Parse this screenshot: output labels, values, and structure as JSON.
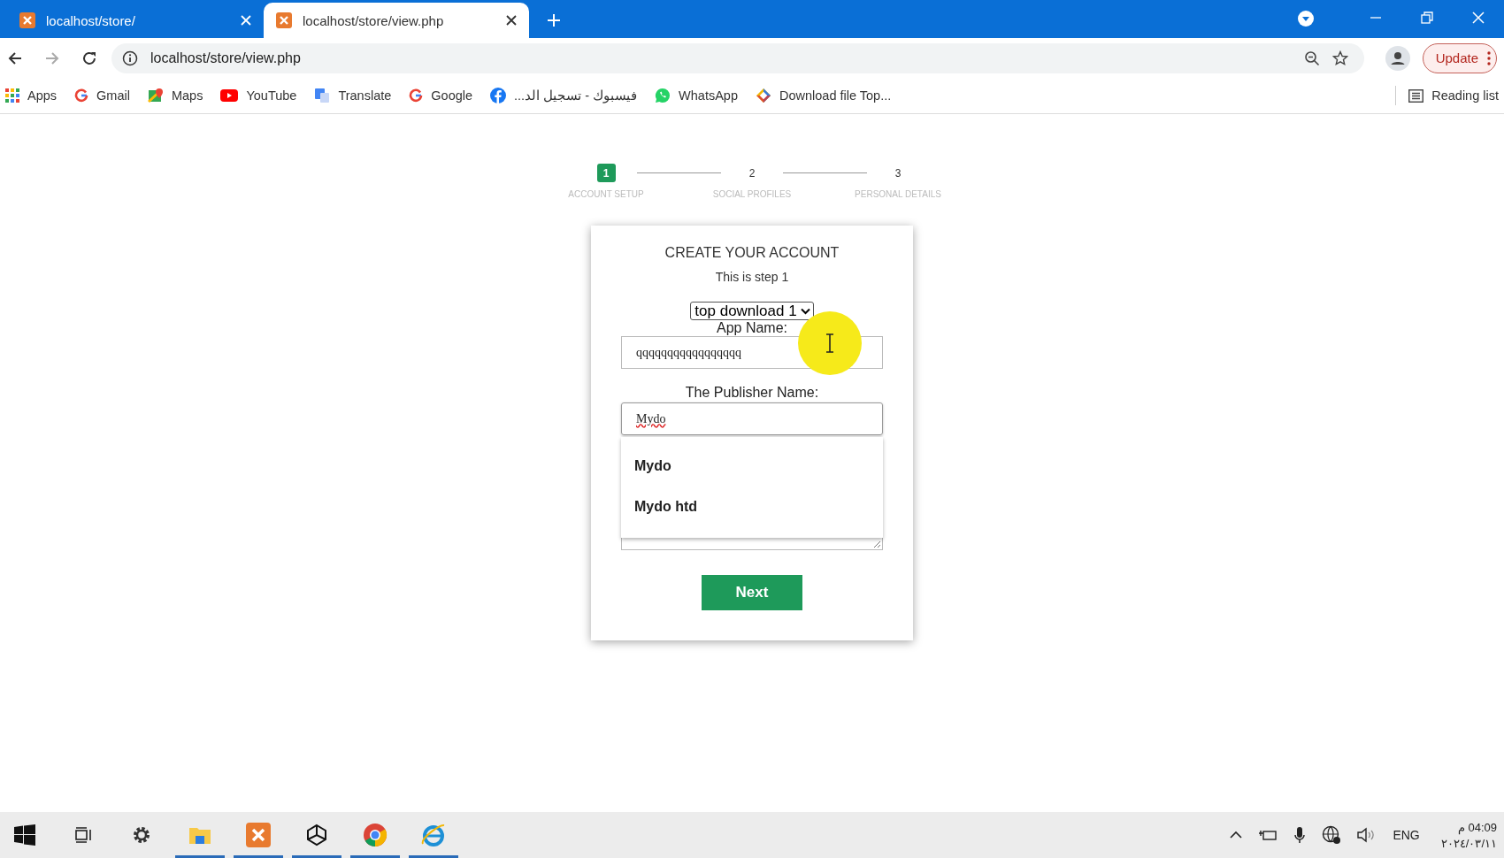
{
  "browser": {
    "tabs": [
      {
        "title": "localhost/store/",
        "selected": false
      },
      {
        "title": "localhost/store/view.php",
        "selected": true
      }
    ],
    "address": "localhost/store/view.php",
    "update_button": "Update",
    "bookmarks": [
      {
        "label": "Apps",
        "kind": "apps"
      },
      {
        "label": "Gmail",
        "kind": "google"
      },
      {
        "label": "Maps",
        "kind": "maps"
      },
      {
        "label": "YouTube",
        "kind": "youtube"
      },
      {
        "label": "Translate",
        "kind": "translate"
      },
      {
        "label": "Google",
        "kind": "google"
      },
      {
        "label": "فيسبوك - تسجيل الد...",
        "kind": "facebook"
      },
      {
        "label": "WhatsApp",
        "kind": "whatsapp"
      },
      {
        "label": "Download file Top...",
        "kind": "download"
      }
    ],
    "reading_list": "Reading list"
  },
  "stepper": [
    {
      "number": "1",
      "label": "ACCOUNT SETUP",
      "selected": true
    },
    {
      "number": "2",
      "label": "SOCIAL PROFILES",
      "selected": false
    },
    {
      "number": "3",
      "label": "PERSONAL DETAILS",
      "selected": false
    }
  ],
  "form": {
    "title": "CREATE YOUR ACCOUNT",
    "subtitle": "This is step 1",
    "select": "top download 1",
    "app_name_label": "App Name:",
    "app_name_value": "qqqqqqqqqqqqqqqqq",
    "publisher_label": "The Publisher Name:",
    "publisher_value": "Mydo",
    "suggestions": [
      "Mydo",
      "Mydo htd"
    ],
    "next_button": "Next"
  },
  "taskbar": {
    "apps": [
      {
        "kind": "start",
        "open": false
      },
      {
        "kind": "taskview",
        "open": false
      },
      {
        "kind": "settings",
        "open": false
      },
      {
        "kind": "files",
        "open": true
      },
      {
        "kind": "xampp",
        "open": true
      },
      {
        "kind": "unity",
        "open": true
      },
      {
        "kind": "chrome",
        "open": true
      },
      {
        "kind": "ie",
        "open": true
      }
    ],
    "language": "ENG",
    "time": "04:09 م",
    "date": "٢٠٢٤/٠٣/١١"
  }
}
